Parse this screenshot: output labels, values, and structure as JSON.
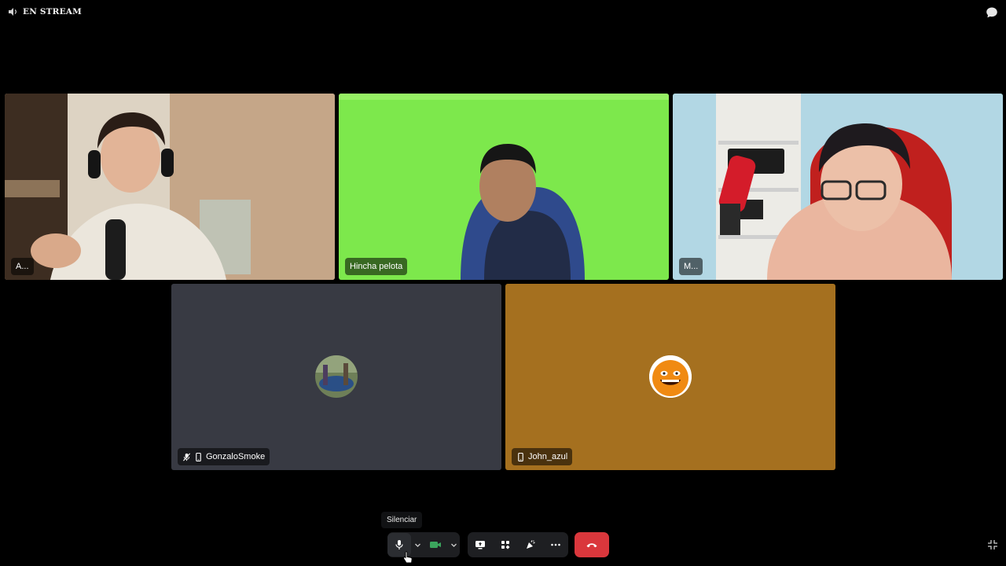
{
  "stream": {
    "label": "EN STREAM"
  },
  "participants": [
    {
      "name": "A...",
      "speaking": false
    },
    {
      "name": "Hincha pelota",
      "speaking": false
    },
    {
      "name": "M...",
      "speaking": true
    },
    {
      "name": "GonzaloSmoke",
      "muted": true,
      "mobile": true,
      "tile_color": "#383a43"
    },
    {
      "name": "John_azul",
      "muted": false,
      "mobile": true,
      "tile_color": "#a5701f"
    }
  ],
  "controls": {
    "tooltip": "Silenciar",
    "icons": [
      "microphone-icon",
      "chevron-down-icon",
      "camera-icon",
      "chevron-down-icon",
      "screen-share-icon",
      "activities-icon",
      "soundboard-icon",
      "more-icon",
      "hang-up-icon",
      "fullscreen-exit-icon"
    ]
  },
  "colors": {
    "speaking_border": "#3ba55d",
    "hang_up": "#da373c",
    "camera_on": "#3ba55d",
    "controls_bg": "#1e1f22"
  }
}
